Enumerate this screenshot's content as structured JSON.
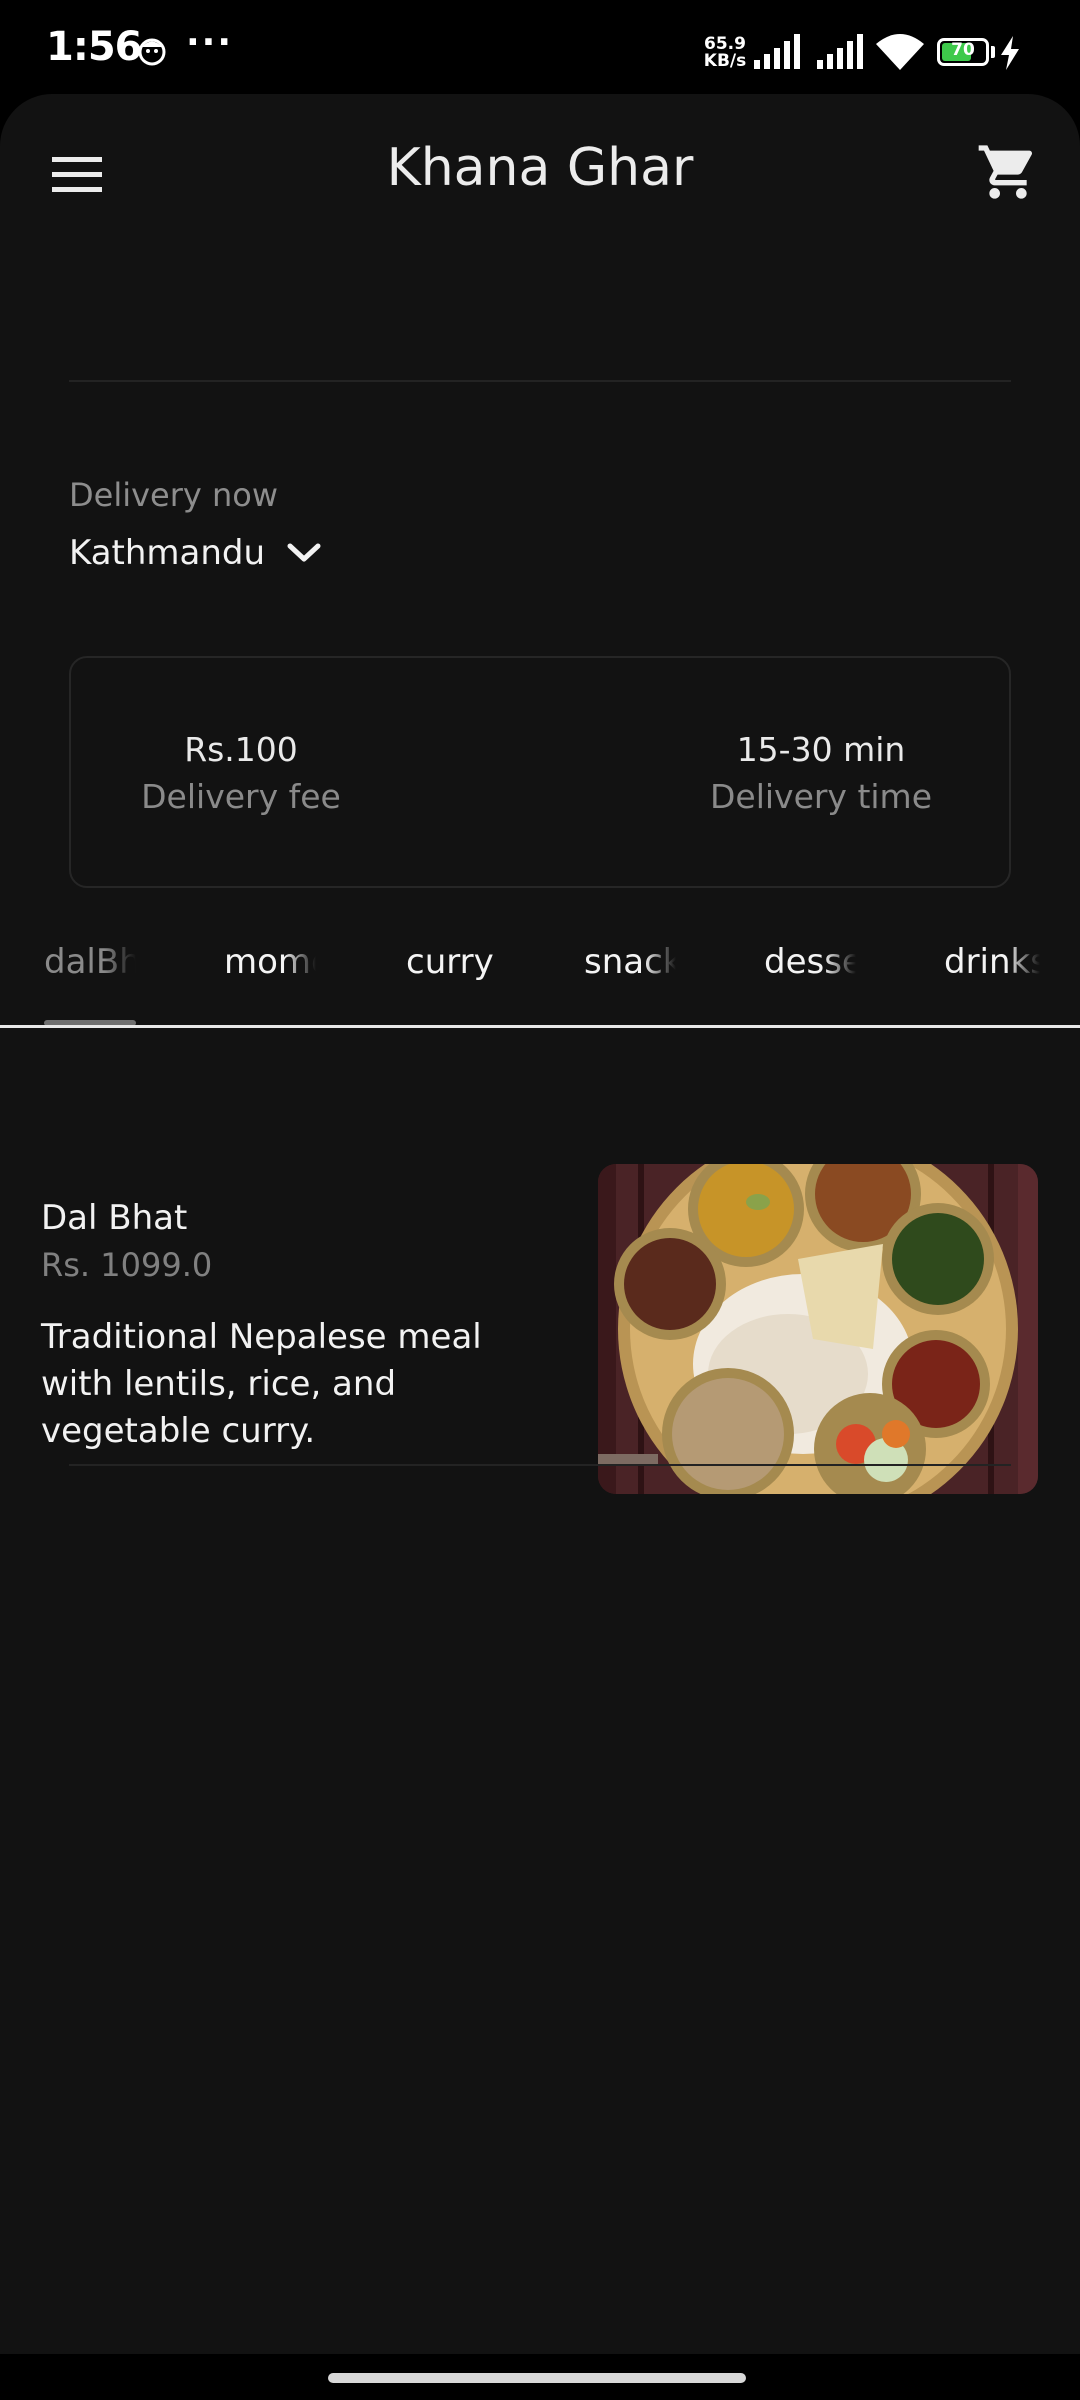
{
  "status_bar": {
    "time": "1:56",
    "more": "···",
    "net_speed_value": "65.9",
    "net_speed_unit": "KB/s",
    "battery_level": "70"
  },
  "header": {
    "title": "Khana Ghar"
  },
  "delivery": {
    "label": "Delivery now",
    "location": "Kathmandu"
  },
  "info_card": {
    "fee_value": "Rs.100",
    "fee_label": "Delivery fee",
    "time_value": "15-30 min",
    "time_label": "Delivery time"
  },
  "tabs": [
    {
      "label": "dalBhat",
      "active": true
    },
    {
      "label": "momo",
      "active": false
    },
    {
      "label": "curry",
      "active": false
    },
    {
      "label": "snacks",
      "active": false
    },
    {
      "label": "dessert",
      "active": false
    },
    {
      "label": "drinks",
      "active": false
    }
  ],
  "menu_items": [
    {
      "name": "Dal Bhat",
      "price": "Rs. 1099.0",
      "description": "Traditional Nepalese meal with lentils, rice, and vegetable curry."
    }
  ],
  "icons": {
    "menu": "hamburger-menu-icon",
    "cart": "shopping-cart-icon",
    "location_dropdown": "chevron-down-icon"
  },
  "colors": {
    "background": "#121212",
    "status_bar": "#000000",
    "text_primary": "#f2f2f2",
    "text_secondary": "#8a8a8a",
    "battery": "#3ec94b"
  }
}
